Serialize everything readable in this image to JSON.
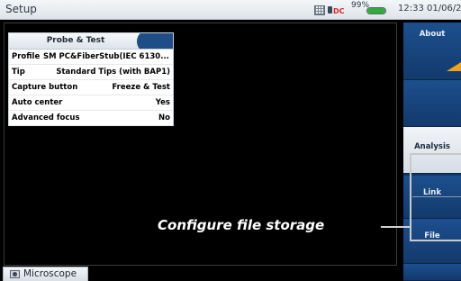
{
  "window": {
    "title": "Setup"
  },
  "status_bar": {
    "grid_icon": "grid-icon",
    "dc_label": "DC",
    "battery_percent": "99%",
    "battery_level": 0.99,
    "clock": "12:33 01/06/2021"
  },
  "probe_panel": {
    "header": "Probe & Test",
    "rows": [
      {
        "key": "Profile",
        "value": "SM PC&FiberStub(IEC 6130..."
      },
      {
        "key": "Tip",
        "value": "Standard Tips (with BAP1)"
      },
      {
        "key": "Capture button",
        "value": "Freeze & Test"
      },
      {
        "key": "Auto center",
        "value": "Yes"
      },
      {
        "key": "Advanced focus",
        "value": "No"
      }
    ]
  },
  "sidebar": {
    "about": "About",
    "analysis": "Analysis",
    "link": "Link",
    "file": "File",
    "accent_color": "#f1a21b"
  },
  "callout": {
    "text": "Configure file storage"
  },
  "bottom_tab": {
    "label": "Microscope",
    "icon": "camera-icon"
  }
}
